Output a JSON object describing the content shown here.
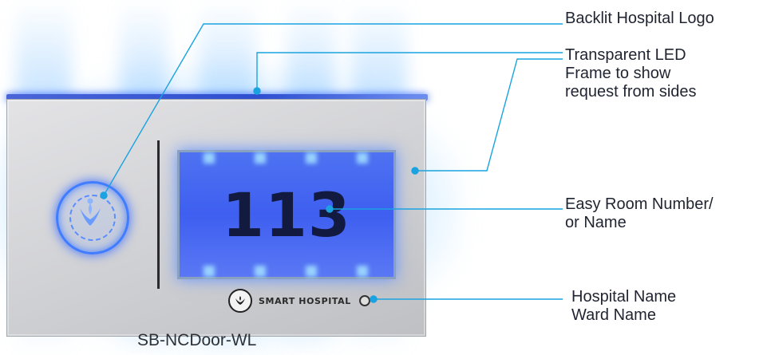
{
  "callouts": {
    "backlit_logo": "Backlit Hospital Logo",
    "led_frame_line1": "Transparent LED",
    "led_frame_line2": "Frame to show",
    "led_frame_line3": "request from sides",
    "room_number_line1": "Easy Room Number/",
    "room_number_line2": "or Name",
    "hospital_name_line1": "Hospital Name",
    "hospital_name_line2": "Ward Name"
  },
  "display": {
    "room_number": "113"
  },
  "brand": {
    "name": "SMART HOSPITAL"
  },
  "caption": "SB-NCDoor-WL",
  "colors": {
    "glow": "#7ec4ff",
    "led_blue": "#3d63f0",
    "leader_line": "#1aa3e0",
    "device_face": "#d7d8db",
    "text": "#1f2430"
  },
  "icons": [
    "hospital-logo-icon",
    "leaf-hand-icon",
    "status-led-icon"
  ]
}
